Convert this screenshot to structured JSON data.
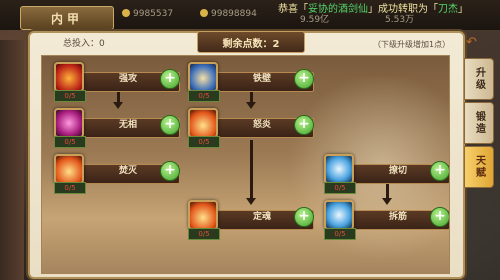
{
  "window": {
    "title": "内甲"
  },
  "resources": [
    {
      "value": "9985537"
    },
    {
      "value": "99898894"
    },
    {
      "value": "9.59亿"
    },
    {
      "value": "5.53万"
    }
  ],
  "notice": {
    "prefix": "恭喜「",
    "name": "妥协的酒剑仙",
    "middle": "」成功转职为「",
    "job": "刀杰",
    "suffix": "」"
  },
  "header": {
    "total_invest": "总投入：0",
    "remaining_points": "剩余点数：2",
    "hint": "（下级升级增加1点）"
  },
  "nodes": [
    {
      "id": "qianggong",
      "label": "强攻",
      "level": "0/5",
      "style": "ic-red"
    },
    {
      "id": "tiebi",
      "label": "铁壁",
      "level": "0/5",
      "style": "ic-blue"
    },
    {
      "id": "wuxiang",
      "label": "无相",
      "level": "0/5",
      "style": "ic-purple"
    },
    {
      "id": "nuyan",
      "label": "怒炎",
      "level": "0/5",
      "style": "ic-fire"
    },
    {
      "id": "fenmie",
      "label": "焚灭",
      "level": "0/5",
      "style": "ic-fire"
    },
    {
      "id": "liaoqie",
      "label": "撩切",
      "level": "0/5",
      "style": "ic-ice"
    },
    {
      "id": "dinghun",
      "label": "定魂",
      "level": "0/5",
      "style": "ic-fire"
    },
    {
      "id": "chaijin",
      "label": "拆筋",
      "level": "0/5",
      "style": "ic-ice"
    }
  ],
  "plus_label": "+",
  "side_tabs": [
    {
      "label": "升级"
    },
    {
      "label": "锻造"
    },
    {
      "label": "天赋"
    }
  ],
  "icons": {
    "back": "back-arrow-icon",
    "help": "help-icon"
  },
  "colors": {
    "accent": "#e0a534",
    "plus_green": "#41a42e",
    "level_red": "#e34b3b"
  }
}
